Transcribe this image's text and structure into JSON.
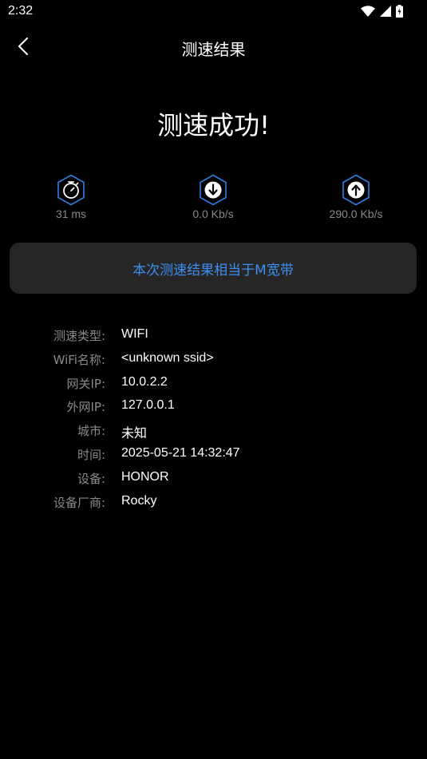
{
  "status_bar": {
    "time": "2:32"
  },
  "app_bar": {
    "title": "测速结果"
  },
  "heading": "测速成功!",
  "metrics": {
    "ping": {
      "value": "31 ms",
      "icon": "stopwatch-icon"
    },
    "download": {
      "value": "0.0 Kb/s",
      "icon": "download-arrow-icon"
    },
    "upload": {
      "value": "290.0 Kb/s",
      "icon": "upload-arrow-icon"
    }
  },
  "result_card": {
    "text": "本次测速结果相当于M宽带"
  },
  "info": [
    {
      "label": "测速类型:",
      "value": "WIFI"
    },
    {
      "label": "WiFi名称:",
      "value": "<unknown ssid>"
    },
    {
      "label": "网关IP:",
      "value": "10.0.2.2"
    },
    {
      "label": "外网IP:",
      "value": "127.0.0.1"
    },
    {
      "label": "城市:",
      "value": "未知"
    },
    {
      "label": "时间:",
      "value": "2025-05-21 14:32:47"
    },
    {
      "label": "设备:",
      "value": "HONOR"
    },
    {
      "label": "设备厂商:",
      "value": "Rocky"
    }
  ],
  "colors": {
    "background": "#000000",
    "card": "#262626",
    "accent": "#3d8ff0",
    "label": "#8a8a8a",
    "icon_stroke": "#2f7fe0"
  }
}
